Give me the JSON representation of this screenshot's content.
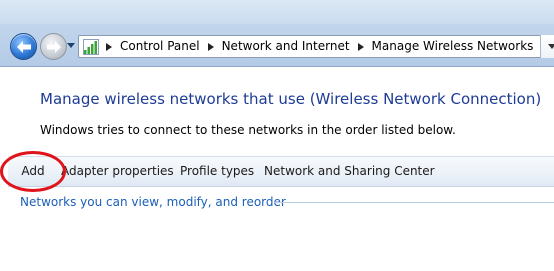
{
  "navigation": {
    "back_icon": "back-arrow-icon",
    "forward_icon": "forward-arrow-icon",
    "recent_icon": "chevron-down-icon",
    "breadcrumb": [
      "Control Panel",
      "Network and Internet",
      "Manage Wireless Networks"
    ],
    "location_icon": "network-signal-icon",
    "end_icon": "chevron-down-icon"
  },
  "main": {
    "title": "Manage wireless networks that use (Wireless Network Connection)",
    "description": "Windows tries to connect to these networks in the order listed below."
  },
  "command_bar": {
    "items": [
      "Add",
      "Adapter properties",
      "Profile types",
      "Network and Sharing Center"
    ]
  },
  "annotation": {
    "color": "#e0131a"
  },
  "networks_section": {
    "label": "Networks you can view, modify, and reorder"
  },
  "colors": {
    "title": "#1e3c96",
    "link": "#1c5fb8"
  }
}
